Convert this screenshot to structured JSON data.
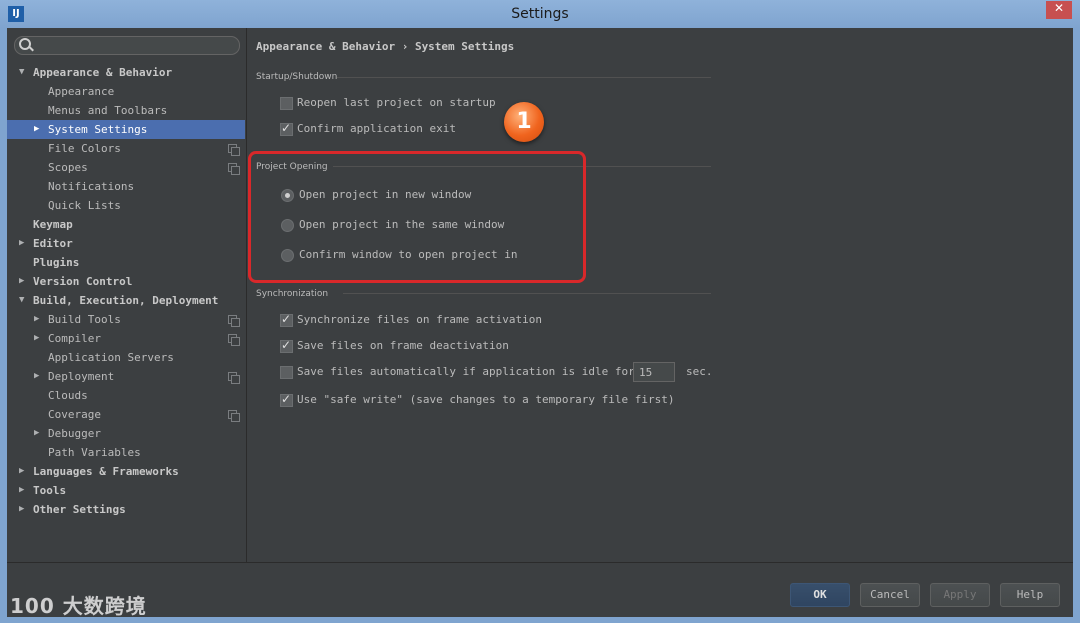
{
  "window": {
    "title": "Settings",
    "close_label": "✕",
    "app_icon_label": "IJ"
  },
  "sidebar": {
    "search_placeholder": "",
    "items": [
      {
        "label": "Appearance & Behavior",
        "arrow": "▼"
      },
      {
        "label": "Appearance"
      },
      {
        "label": "Menus and Toolbars"
      },
      {
        "label": "System Settings",
        "arrow": "▶"
      },
      {
        "label": "File Colors"
      },
      {
        "label": "Scopes"
      },
      {
        "label": "Notifications"
      },
      {
        "label": "Quick Lists"
      },
      {
        "label": "Keymap"
      },
      {
        "label": "Editor",
        "arrow": "▶"
      },
      {
        "label": "Plugins"
      },
      {
        "label": "Version Control",
        "arrow": "▶"
      },
      {
        "label": "Build, Execution, Deployment",
        "arrow": "▼"
      },
      {
        "label": "Build Tools",
        "arrow": "▶"
      },
      {
        "label": "Compiler",
        "arrow": "▶"
      },
      {
        "label": "Application Servers"
      },
      {
        "label": "Deployment",
        "arrow": "▶"
      },
      {
        "label": "Clouds"
      },
      {
        "label": "Coverage"
      },
      {
        "label": "Debugger",
        "arrow": "▶"
      },
      {
        "label": "Path Variables"
      },
      {
        "label": "Languages & Frameworks",
        "arrow": "▶"
      },
      {
        "label": "Tools",
        "arrow": "▶"
      },
      {
        "label": "Other Settings",
        "arrow": "▶"
      }
    ]
  },
  "main": {
    "breadcrumb": "Appearance & Behavior › System Settings",
    "startup": {
      "title": "Startup/Shutdown",
      "reopen_label": "Reopen last project on startup",
      "reopen_checked": false,
      "confirm_exit_label": "Confirm application exit",
      "confirm_exit_checked": true
    },
    "project_opening": {
      "title": "Project Opening",
      "options": [
        "Open project in new window",
        "Open project in the same window",
        "Confirm window to open project in"
      ],
      "selected_index": 0
    },
    "sync": {
      "title": "Synchronization",
      "sync_on_activation": "Synchronize files on frame activation",
      "save_on_deactivation": "Save files on frame deactivation",
      "save_idle_label": "Save files automatically if application is idle for",
      "save_idle_value": "15",
      "save_idle_unit": "sec.",
      "safe_write": "Use \"safe write\" (save changes to a temporary file first)"
    },
    "badge_number": "1"
  },
  "footer": {
    "ok": "OK",
    "cancel": "Cancel",
    "apply": "Apply",
    "help": "Help"
  },
  "watermark": "100 大数跨境"
}
